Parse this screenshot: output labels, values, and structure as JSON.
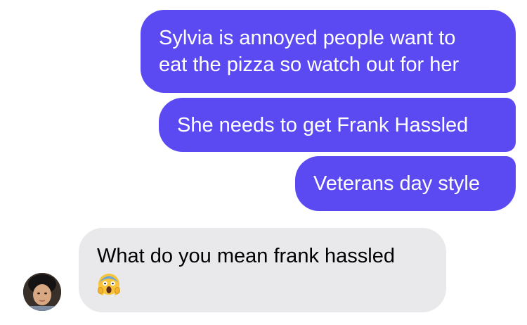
{
  "messages": {
    "sent": [
      {
        "lines": [
          "Sylvia is annoyed people want to",
          "eat the pizza so watch out for her"
        ]
      },
      {
        "lines": [
          "She needs to get Frank Hassled"
        ]
      },
      {
        "lines": [
          "Veterans day style"
        ]
      }
    ],
    "received": {
      "text": "What do you mean frank hassled",
      "emoji": "face-screaming-in-fear-icon"
    }
  },
  "colors": {
    "sent_bubble": "#5b4af2",
    "received_bubble": "#e9e9eb",
    "sent_text": "#ffffff",
    "received_text": "#000000"
  }
}
